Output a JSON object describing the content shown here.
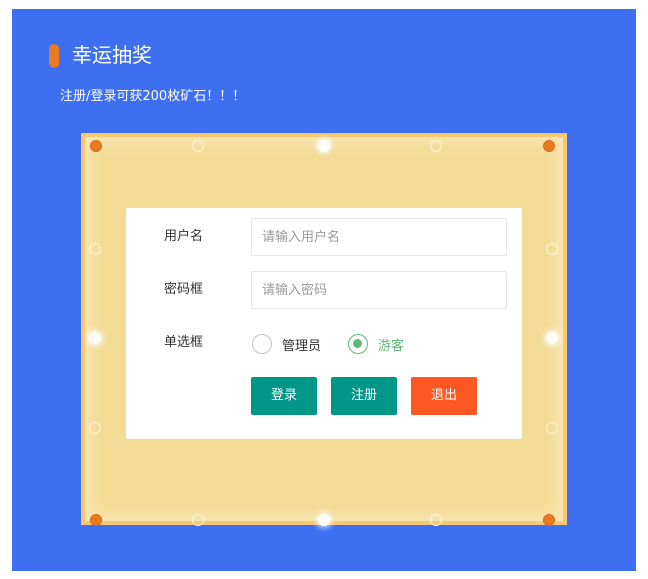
{
  "header": {
    "title": "幸运抽奖",
    "subtitle": "注册/登录可获200枚矿石！！！"
  },
  "form": {
    "username": {
      "label": "用户名",
      "placeholder": "请输入用户名",
      "value": ""
    },
    "password": {
      "label": "密码框",
      "placeholder": "请输入密码",
      "value": ""
    },
    "role": {
      "label": "单选框",
      "options": [
        {
          "label": "管理员",
          "selected": false
        },
        {
          "label": "游客",
          "selected": true
        }
      ]
    },
    "buttons": {
      "login": "登录",
      "register": "注册",
      "exit": "退出"
    }
  },
  "colors": {
    "panel": "#3d6ff0",
    "board": "#f3db96",
    "accent": "#e87a20",
    "teal_button": "#009688",
    "orange_button": "#ff5722",
    "radio_checked": "#5fb878"
  },
  "icons": {
    "title_marker": "orange-pill-bar",
    "board_lights": "lottery-board-light-dots"
  }
}
